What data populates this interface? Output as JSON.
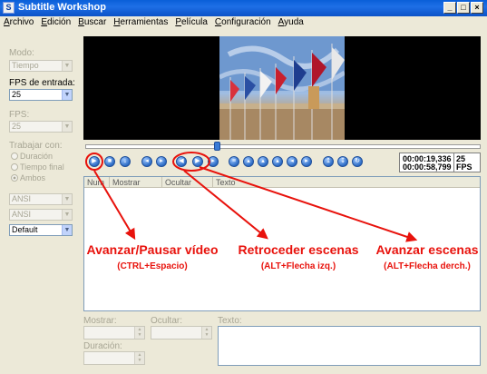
{
  "window": {
    "title": "Subtitle Workshop"
  },
  "menu": [
    "Archivo",
    "Edición",
    "Buscar",
    "Herramientas",
    "Película",
    "Configuración",
    "Ayuda"
  ],
  "left_panel": {
    "mode_label": "Modo:",
    "mode_value": "Tiempo",
    "fps_in_label": "FPS de entrada:",
    "fps_in_value": "25",
    "fps_label": "FPS:",
    "fps_value": "25",
    "work_with_label": "Trabajar con:",
    "radios": [
      "Duración",
      "Tiempo final",
      "Ambos"
    ],
    "selected_radio": "Ambos",
    "charset1": "ANSI",
    "charset2": "ANSI",
    "style": "Default"
  },
  "player": {
    "time_current": "00:00:19,336",
    "time_total": "00:00:58,799",
    "fps_number": "25",
    "fps_unit": "FPS",
    "position_fraction": 0.33
  },
  "list_columns": [
    "Num",
    "Mostrar",
    "Ocultar",
    "Texto"
  ],
  "editor": {
    "show_label": "Mostrar:",
    "hide_label": "Ocultar:",
    "text_label": "Texto:",
    "duration_label": "Duración:"
  },
  "annotations": {
    "play": {
      "title": "Avanzar/Pausar vídeo",
      "shortcut": "(CTRL+Espacio)"
    },
    "rewind": {
      "title": "Retroceder escenas",
      "shortcut": "(ALT+Flecha izq.)"
    },
    "forward": {
      "title": "Avanzar escenas",
      "shortcut": "(ALT+Flecha derch.)"
    },
    "color": "#e8120c"
  }
}
